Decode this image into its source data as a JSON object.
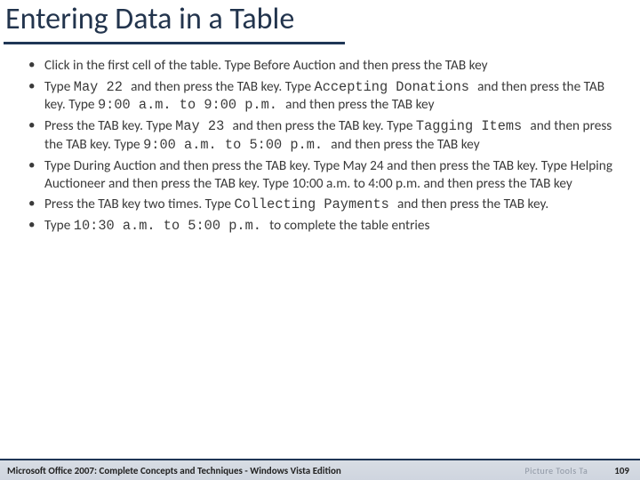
{
  "title": "Entering Data in a Table",
  "bullets": [
    {
      "segments": [
        {
          "t": "Click in the first cell of the table. Type Before Auction and then press the TAB key"
        }
      ]
    },
    {
      "segments": [
        {
          "t": "Type "
        },
        {
          "t": "May 22 ",
          "mono": true
        },
        {
          "t": "and then press the TAB key. Type "
        },
        {
          "t": "Accepting Donations ",
          "mono": true
        },
        {
          "t": "and then press the TAB key. Type "
        },
        {
          "t": "9:00 a.m. to 9:00 p.m. ",
          "mono": true
        },
        {
          "t": "and then press the TAB key"
        }
      ]
    },
    {
      "segments": [
        {
          "t": "Press the TAB key. Type "
        },
        {
          "t": "May 23 ",
          "mono": true
        },
        {
          "t": "and then press the TAB key. Type "
        },
        {
          "t": "Tagging Items ",
          "mono": true
        },
        {
          "t": "and then press the TAB key. Type "
        },
        {
          "t": "9:00 a.m. to 5:00 p.m. ",
          "mono": true
        },
        {
          "t": "and then press the TAB key"
        }
      ]
    },
    {
      "segments": [
        {
          "t": "Type During Auction and then press the TAB key. Type May 24 and then press the TAB key. Type Helping Auctioneer and then press the TAB key. Type 10:00 a.m. to 4:00 p.m. and then press the TAB key"
        }
      ]
    },
    {
      "segments": [
        {
          "t": "Press the TAB key two times. Type "
        },
        {
          "t": "Collecting Payments ",
          "mono": true
        },
        {
          "t": "and then press the TAB key."
        }
      ]
    },
    {
      "segments": [
        {
          "t": "Type "
        },
        {
          "t": "10:30 a.m. to 5:00 p.m. ",
          "mono": true
        },
        {
          "t": "to complete the table entries"
        }
      ]
    }
  ],
  "footer": {
    "source": "Microsoft Office 2007: Complete Concepts and Techniques - Windows Vista Edition",
    "ghost": "Picture Tools    Ta",
    "page": "109"
  }
}
